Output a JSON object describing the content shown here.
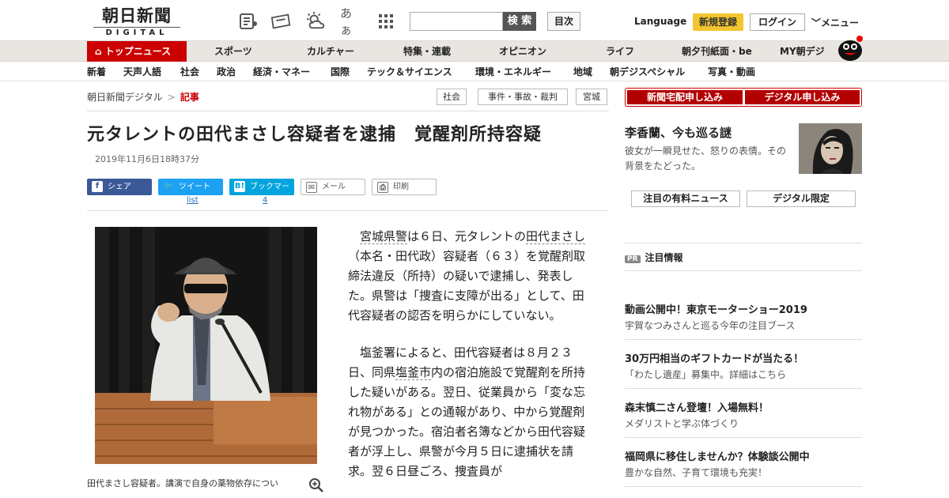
{
  "header": {
    "logo_title": "朝日新聞",
    "logo_sub": "DIGITAL",
    "icon_kana": "あぁ",
    "search_button": "検 索",
    "toc_button": "目次",
    "language": "Language",
    "register": "新規登録",
    "login": "ログイン",
    "menu": "メニュー"
  },
  "nav_primary": [
    "トップニュース",
    "スポーツ",
    "カルチャー",
    "特集・連載",
    "オピニオン",
    "ライフ",
    "朝夕刊紙面・be",
    "MY朝デジ"
  ],
  "nav_secondary": [
    "新着",
    "天声人語",
    "社会",
    "政治",
    "経済・マネー",
    "国際",
    "テック＆サイエンス",
    "環境・エネルギー",
    "地域",
    "朝デジスペシャル",
    "写真・動画"
  ],
  "breadcrumb": {
    "root": "朝日新聞デジタル",
    "sep": ">",
    "current": "記事"
  },
  "tags": [
    "社会",
    "事件・事故・裁判",
    "宮城"
  ],
  "article": {
    "title": "元タレントの田代まさし容疑者を逮捕　覚醒剤所持容疑",
    "date": "2019年11月6日18時37分",
    "share": {
      "facebook": "シェア",
      "twitter": "ツイート",
      "hatena": "ブックマーク",
      "mail": "メール",
      "print": "印刷",
      "twitter_count": "list",
      "hatena_count": "4"
    },
    "caption": "田代まさし容疑者。講演で自身の薬物依存につい",
    "p1_link1": "宮城県警",
    "p1_a": "は６日、元タレントの",
    "p1_link2": "田代まさし",
    "p1_b": "（本名・田代政）容疑者（６３）を覚醒剤取締法違反（所持）の疑いで逮捕し、発表した。県警は「捜査に支障が出る」として、田代容疑者の認否を明らかにしていない。",
    "p2_a": "塩釜署によると、田代容疑者は８月２３日、同県",
    "p2_link": "塩釜市",
    "p2_b": "内の宿泊施設で覚醒剤を所持した疑いがある。翌日、従業員から「変な忘れ物がある」との通報があり、中から覚醒剤が見つかった。宿泊者名簿などから田代容疑者が浮上し、県警が今月５日に逮捕状を請求。翌６日昼ごろ、捜査員が"
  },
  "sidebar": {
    "delivery": "新聞宅配申し込み",
    "digital": "デジタル申し込み",
    "feature_title": "李香蘭、今も巡る謎",
    "feature_desc": "彼女が一瞬見せた、怒りの表情。その背景をたどった。",
    "paid_news": "注目の有料ニュース",
    "digital_only": "デジタル限定",
    "pr_badge": "PR",
    "pr_label": "注目情報",
    "promos": [
      {
        "title": "動画公開中！東京モーターショー2019",
        "sub": "宇賀なつみさんと巡る今年の注目ブース"
      },
      {
        "title": "30万円相当のギフトカードが当たる！",
        "sub": "「わたし遺産」募集中。詳細はこちら"
      },
      {
        "title": "森末慎二さん登壇！入場無料！",
        "sub": "メダリストと学ぶ体づくり"
      },
      {
        "title": "福岡県に移住しませんか？体験談公開中",
        "sub": "豊かな自然、子育て環境も充実！"
      }
    ]
  },
  "colors": {
    "accent_red": "#cc0000",
    "register_yellow": "#f3c52e",
    "facebook": "#3b5998",
    "twitter": "#1da1f2",
    "hatena": "#00a4de"
  }
}
